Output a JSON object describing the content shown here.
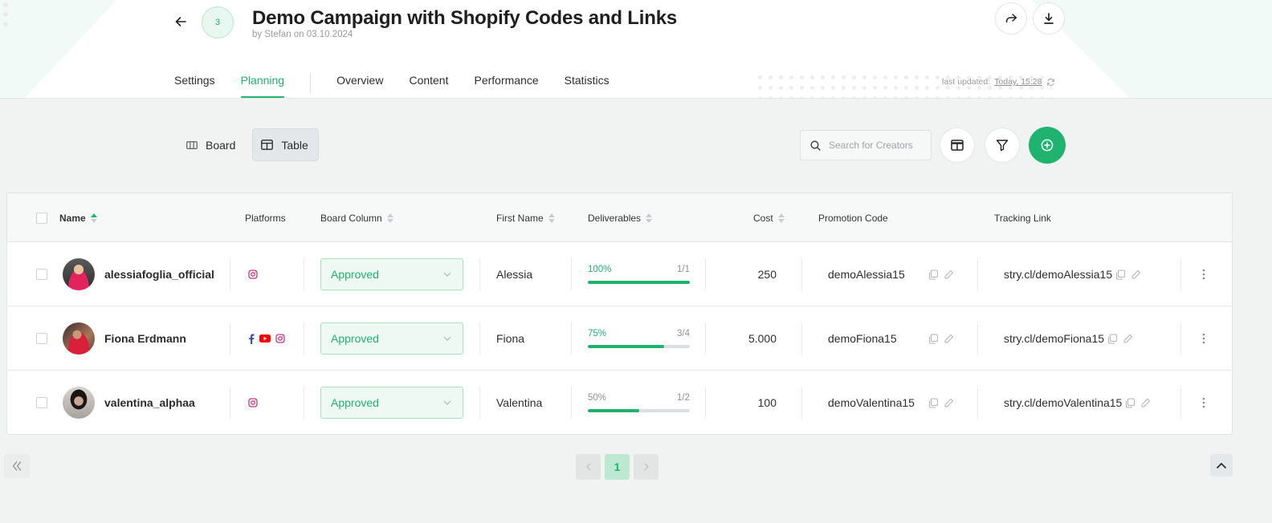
{
  "header": {
    "step_number": "3",
    "title": "Demo Campaign with Shopify Codes and Links",
    "subtitle": "by Stefan on 03.10.2024",
    "last_updated_label": "last updated:",
    "last_updated_value": "Today, 15:28"
  },
  "tabs": [
    {
      "label": "Settings",
      "active": false
    },
    {
      "label": "Planning",
      "active": true
    },
    {
      "label": "Overview",
      "active": false
    },
    {
      "label": "Content",
      "active": false
    },
    {
      "label": "Performance",
      "active": false
    },
    {
      "label": "Statistics",
      "active": false
    }
  ],
  "toolbar": {
    "board_label": "Board",
    "table_label": "Table",
    "active_view": "Table",
    "search_placeholder": "Search for Creators",
    "search_value": ""
  },
  "table": {
    "columns": {
      "name": "Name",
      "platforms": "Platforms",
      "board_column": "Board Column",
      "first_name": "First Name",
      "deliverables": "Deliverables",
      "cost": "Cost",
      "promotion_code": "Promotion Code",
      "tracking_link": "Tracking Link"
    },
    "sort": {
      "column": "Name",
      "direction": "asc"
    },
    "rows": [
      {
        "name": "alessiafoglia_official",
        "platforms": [
          "instagram"
        ],
        "board_column": "Approved",
        "first_name": "Alessia",
        "deliverables_pct": "100%",
        "deliverables_count": "1/1",
        "deliverables_progress": 1.0,
        "cost": "250",
        "promotion_code": "demoAlessia15",
        "tracking_link": "stry.cl/demoAlessia15"
      },
      {
        "name": "Fiona Erdmann",
        "platforms": [
          "facebook",
          "youtube",
          "instagram"
        ],
        "board_column": "Approved",
        "first_name": "Fiona",
        "deliverables_pct": "75%",
        "deliverables_count": "3/4",
        "deliverables_progress": 0.75,
        "cost": "5.000",
        "promotion_code": "demoFiona15",
        "tracking_link": "stry.cl/demoFiona15"
      },
      {
        "name": "valentina_alphaa",
        "platforms": [
          "instagram"
        ],
        "board_column": "Approved",
        "first_name": "Valentina",
        "deliverables_pct": "50%",
        "deliverables_count": "1/2",
        "deliverables_progress": 0.5,
        "cost": "100",
        "promotion_code": "demoValentina15",
        "tracking_link": "stry.cl/demoValentina15"
      }
    ]
  },
  "pagination": {
    "current_page": "1",
    "pages": [
      "1"
    ]
  },
  "colors": {
    "accent": "#1fb36f",
    "instagram": "#c13584",
    "facebook": "#3b5998",
    "youtube": "#ff0000"
  }
}
